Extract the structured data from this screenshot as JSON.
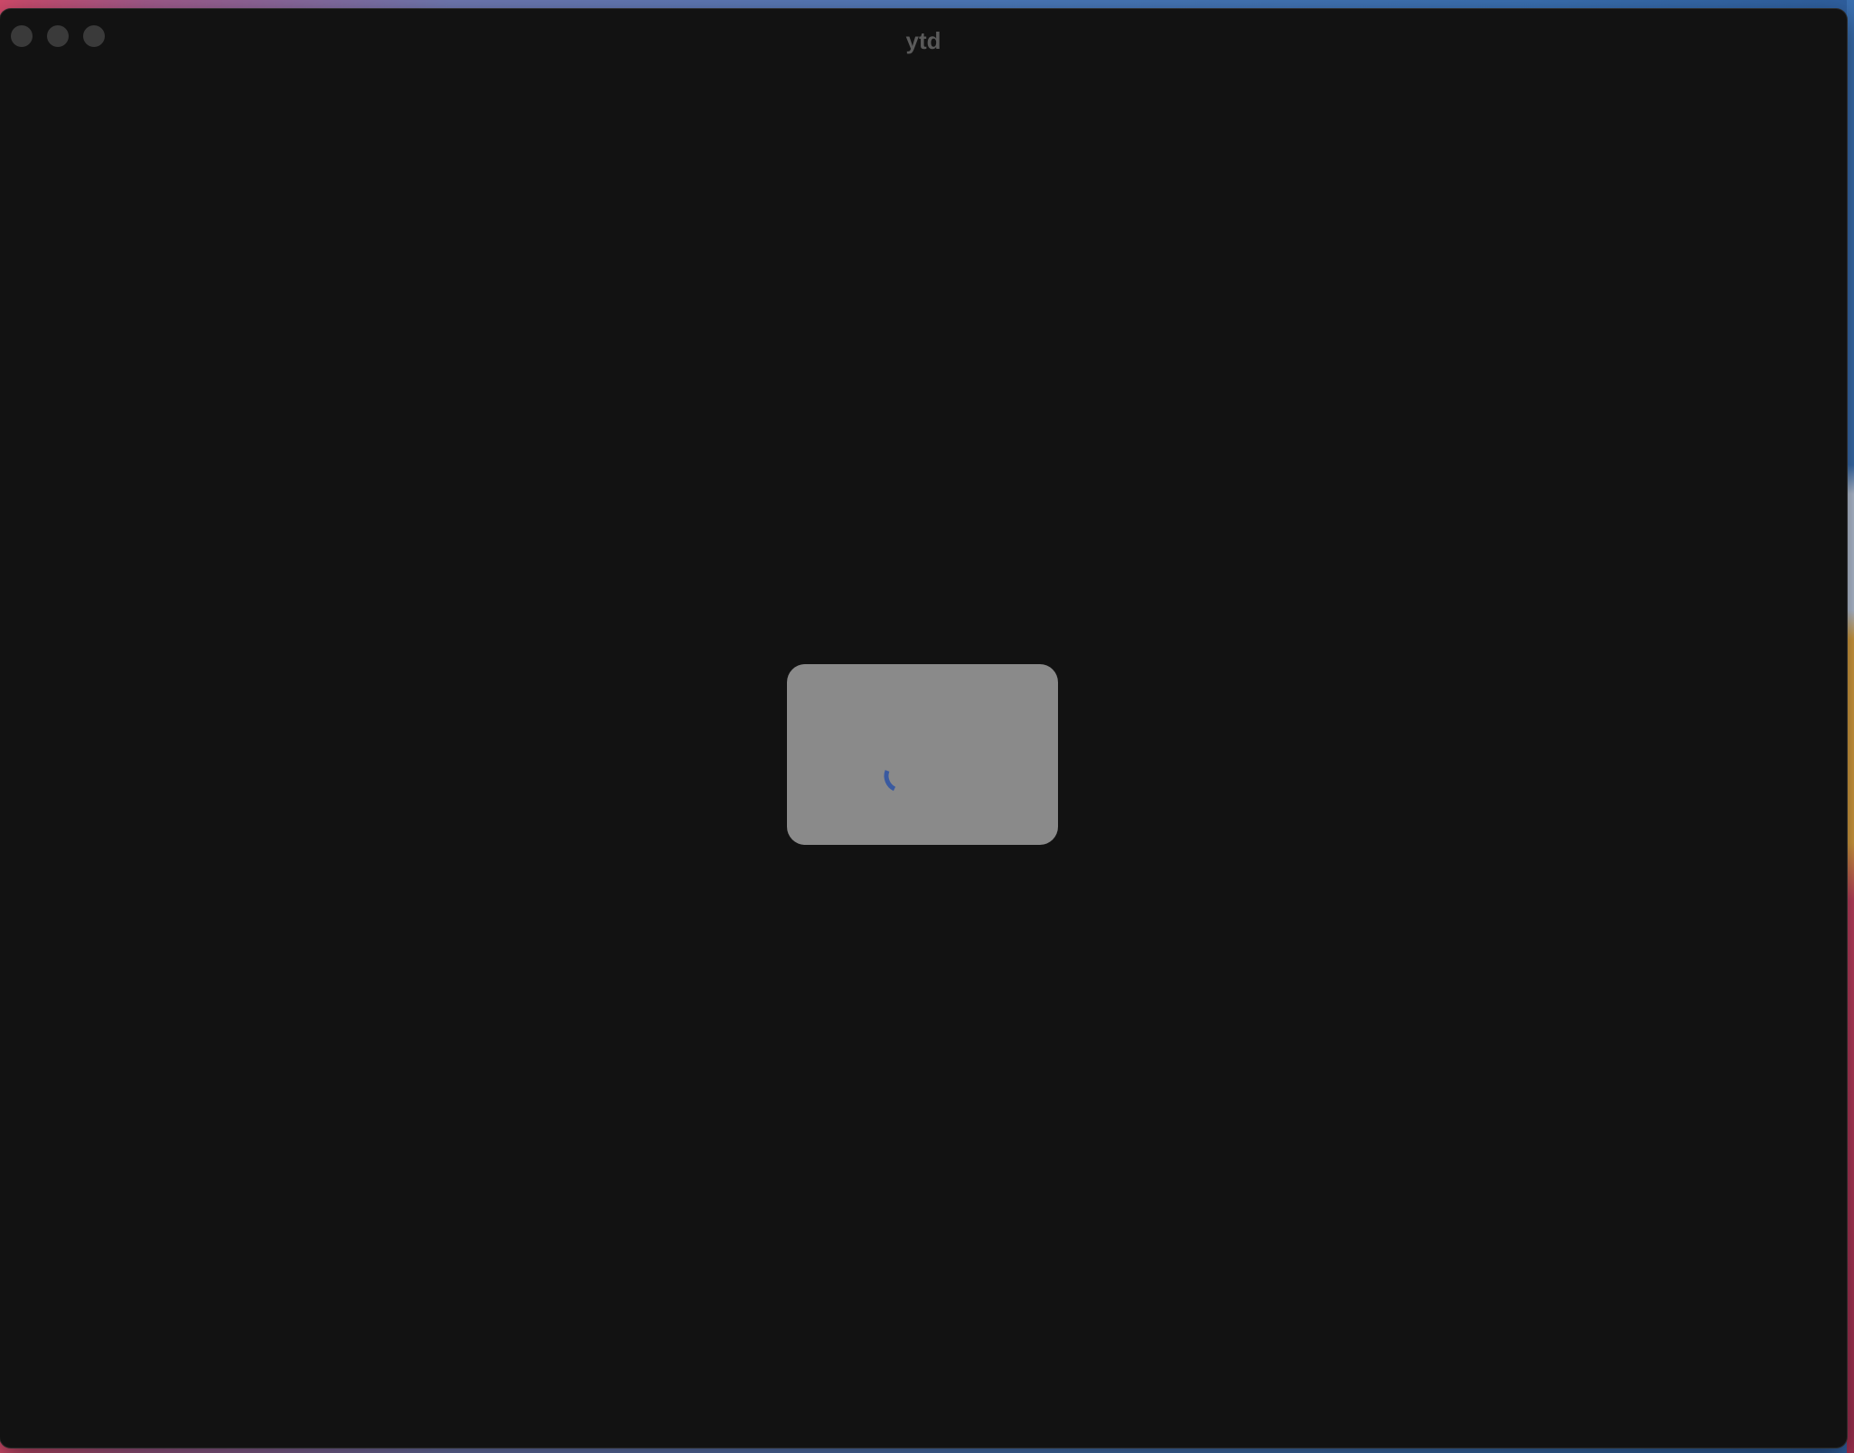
{
  "window": {
    "title": "ytd"
  },
  "icons": {
    "close": "close-button-icon",
    "minimize": "minimize-button-icon",
    "zoom": "zoom-button-icon",
    "spinner": "loading-spinner-icon"
  },
  "colors": {
    "window_bg": "#121212",
    "dialog_bg": "#8a8a8a",
    "spinner": "#3a5aa0"
  }
}
